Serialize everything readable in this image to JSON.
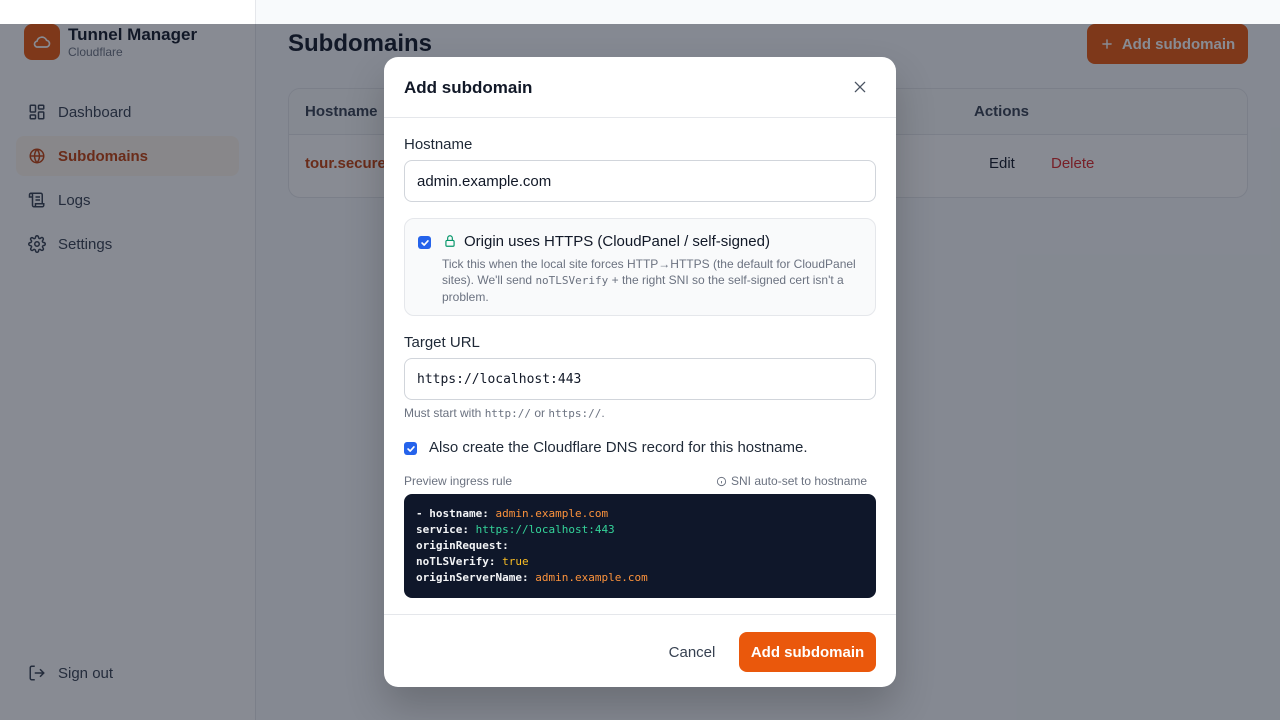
{
  "sidebar": {
    "brand_title": "Tunnel Manager",
    "brand_sub": "Cloudflare",
    "items": [
      {
        "label": "Dashboard",
        "icon": "dashboard-icon"
      },
      {
        "label": "Subdomains",
        "icon": "globe-icon",
        "active": true
      },
      {
        "label": "Logs",
        "icon": "scroll-icon"
      },
      {
        "label": "Settings",
        "icon": "gear-icon"
      }
    ],
    "signout_label": "Sign out"
  },
  "main": {
    "title": "Subdomains",
    "add_button": "Add subdomain",
    "table": {
      "headers": {
        "hostname": "Hostname",
        "actions": "Actions"
      },
      "rows": [
        {
          "hostname": "tour.secures",
          "edit": "Edit",
          "delete": "Delete"
        }
      ]
    }
  },
  "modal": {
    "title": "Add subdomain",
    "hostname_label": "Hostname",
    "hostname_value": "admin.example.com",
    "https_checked": true,
    "https_title": "Origin uses HTTPS (CloudPanel / self-signed)",
    "https_desc_1": "Tick this when the local site forces HTTP→HTTPS (the default for CloudPanel sites). We'll send ",
    "https_desc_code": "noTLSVerify",
    "https_desc_2": " + the right SNI so the self-signed cert isn't a problem.",
    "target_label": "Target URL",
    "target_value": "https://localhost:443",
    "hint_prefix": "Must start with ",
    "hint_code_1": "http://",
    "hint_or": " or ",
    "hint_code_2": "https://",
    "hint_suffix": ".",
    "dns_checked": true,
    "dns_label": "Also create the Cloudflare DNS record for this hostname.",
    "preview_label": "Preview ingress rule",
    "sni_note": "SNI auto-set to hostname",
    "code": {
      "l1_key": "- hostname: ",
      "l1_val": "admin.example.com",
      "l2_key": "service: ",
      "l2_val": "https://localhost:443",
      "l3_key": "originRequest:",
      "l4_key": "noTLSVerify: ",
      "l4_val": "true",
      "l5_key": "originServerName: ",
      "l5_val": "admin.example.com"
    },
    "cancel": "Cancel",
    "submit": "Add subdomain"
  },
  "colors": {
    "accent": "#ea580c",
    "checkbox": "#2563eb",
    "code_bg": "#0f172a"
  }
}
